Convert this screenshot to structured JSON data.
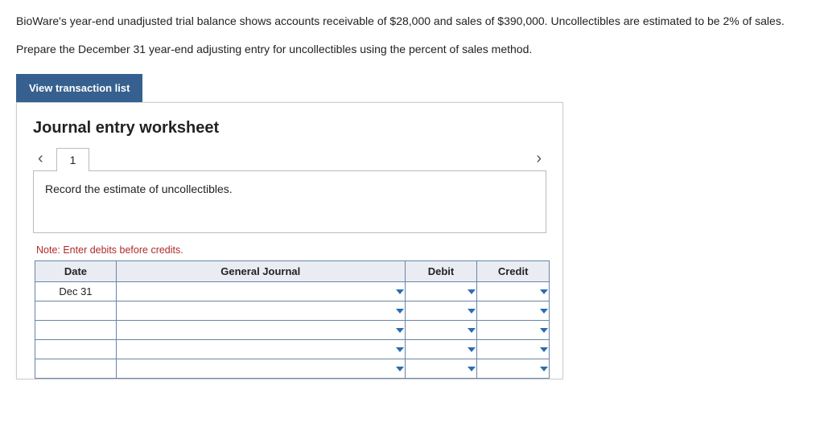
{
  "problem": {
    "paragraph1": "BioWare's year-end unadjusted trial balance shows accounts receivable of $28,000 and sales of $390,000. Uncollectibles are estimated to be 2% of sales.",
    "paragraph2": "Prepare the December 31 year-end adjusting entry for uncollectibles using the percent of sales method."
  },
  "buttons": {
    "view_transaction_list": "View transaction list"
  },
  "worksheet": {
    "title": "Journal entry worksheet",
    "tab_label": "1",
    "instruction": "Record the estimate of uncollectibles.",
    "note": "Note: Enter debits before credits.",
    "headers": {
      "date": "Date",
      "general_journal": "General Journal",
      "debit": "Debit",
      "credit": "Credit"
    },
    "rows": [
      {
        "date": "Dec 31",
        "gj": "",
        "debit": "",
        "credit": ""
      },
      {
        "date": "",
        "gj": "",
        "debit": "",
        "credit": ""
      },
      {
        "date": "",
        "gj": "",
        "debit": "",
        "credit": ""
      },
      {
        "date": "",
        "gj": "",
        "debit": "",
        "credit": ""
      },
      {
        "date": "",
        "gj": "",
        "debit": "",
        "credit": ""
      }
    ]
  }
}
